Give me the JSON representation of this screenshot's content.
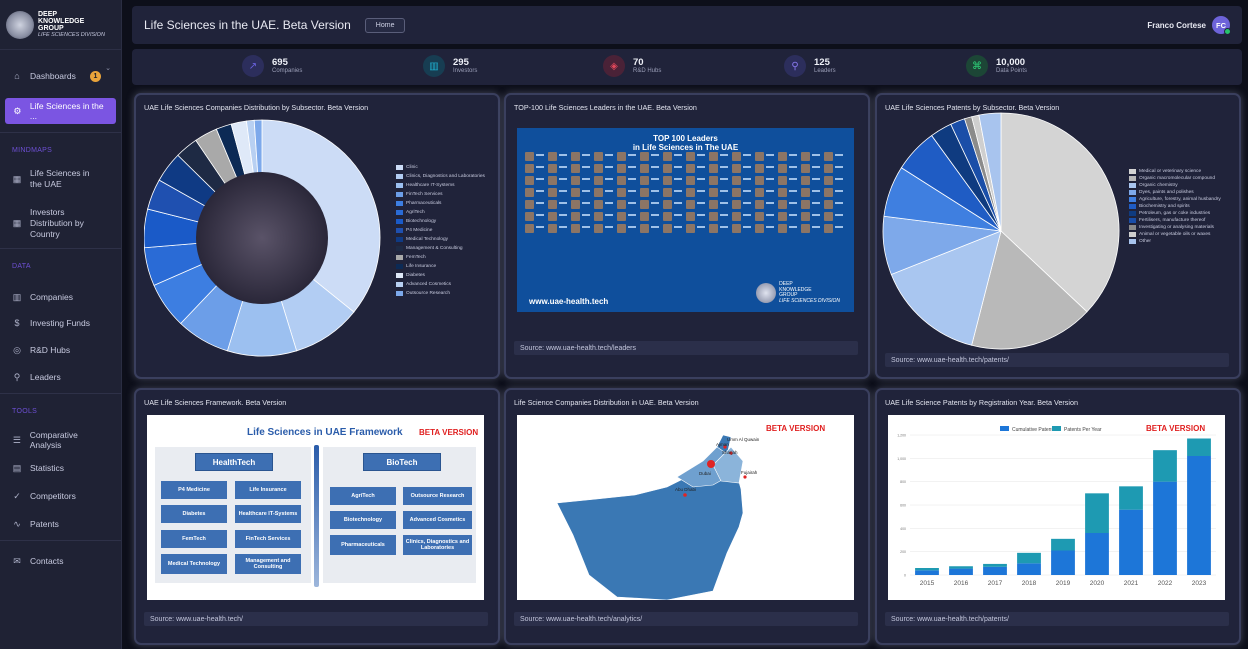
{
  "brand": {
    "line1": "DEEP",
    "line2": "KNOWLEDGE",
    "line3": "GROUP",
    "line4": "LIFE SCIENCES DIVISION"
  },
  "sidebar": {
    "dashboard": {
      "label": "Dashboards",
      "badge": "1"
    },
    "active": {
      "label": "Life Sciences in the ..."
    },
    "sections": {
      "mindmaps": "MINDMAPS",
      "data": "DATA",
      "tools": "TOOLS"
    },
    "mindmaps": [
      {
        "label": "Life Sciences in the UAE"
      },
      {
        "label": "Investors Distribution by Country"
      }
    ],
    "data": [
      {
        "label": "Companies"
      },
      {
        "label": "Investing Funds"
      },
      {
        "label": "R&D Hubs"
      },
      {
        "label": "Leaders"
      }
    ],
    "tools": [
      {
        "label": "Comparative Analysis"
      },
      {
        "label": "Statistics"
      },
      {
        "label": "Competitors"
      },
      {
        "label": "Patents"
      }
    ],
    "contacts": {
      "label": "Contacts"
    }
  },
  "header": {
    "title": "Life Sciences in the UAE. Beta Version",
    "home_label": "Home",
    "user_name": "Franco Cortese",
    "user_initials": "FC"
  },
  "stats": [
    {
      "value": "695",
      "label": "Companies",
      "icon": "trend-icon",
      "color": "#6a63e0",
      "bg": "#2c2e5c"
    },
    {
      "value": "295",
      "label": "Investors",
      "icon": "building-icon",
      "color": "#1fb5d6",
      "bg": "#173d52"
    },
    {
      "value": "70",
      "label": "R&D Hubs",
      "icon": "cube-icon",
      "color": "#e0475a",
      "bg": "#4a2237"
    },
    {
      "value": "125",
      "label": "Leaders",
      "icon": "user-icon",
      "color": "#8a7af0",
      "bg": "#2c2e5c"
    },
    {
      "value": "10,000",
      "label": "Data Points",
      "icon": "command-icon",
      "color": "#2ed47a",
      "bg": "#1c4636"
    }
  ],
  "cards": {
    "subsector": {
      "title": "UAE Life Sciences Companies Distribution by Subsector. Beta Version"
    },
    "leaders": {
      "title": "TOP-100 Life Sciences Leaders in the UAE. Beta Version",
      "banner_line1": "TOP 100 Leaders",
      "banner_line2": "in Life Sciences in The UAE",
      "banner_url": "www.uae-health.tech",
      "logo_line1": "DEEP",
      "logo_line2": "KNOWLEDGE",
      "logo_line3": "GROUP",
      "logo_line4": "LIFE SCIENCES DIVISION",
      "source": "Source:  www.uae-health.tech/leaders"
    },
    "patents_subsector": {
      "title": "UAE Life Sciences Patents by Subsector. Beta Version",
      "source": "Source: www.uae-health.tech/patents/"
    },
    "framework": {
      "title": "UAE Life Sciences Framework. Beta Version",
      "diagram_title": "Life Sciences in UAE Framework",
      "beta": "BETA VERSION",
      "healthtech": "HealthTech",
      "biotech": "BioTech",
      "health_items": [
        "P4 Medicine",
        "Life Insurance",
        "Diabetes",
        "Healthcare IT-Systems",
        "FemTech",
        "FinTech Services",
        "Medical Technology",
        "Management and Consulting"
      ],
      "bio_items": [
        "AgriTech",
        "Outsource Research",
        "Biotechnology",
        "Advanced Cosmetics",
        "Pharmaceuticals",
        "Clinics, Diagnostics and Laboratories"
      ],
      "source": "Source: www.uae-health.tech/"
    },
    "map": {
      "title": "Life Science Companies Distribution in UAE. Beta Version",
      "beta": "BETA VERSION",
      "labels": [
        "Ajman",
        "Umm Al Quwain",
        "Sharjah",
        "Fujairah",
        "Dubai",
        "Abu Dhabi"
      ],
      "source": "Source: www.uae-health.tech/analytics/"
    },
    "patents_year": {
      "title": "UAE Life Science Patents by Registration Year. Beta Version",
      "beta": "BETA VERSION",
      "source": "Source: www.uae-health.tech/patents/"
    }
  },
  "chart_data": [
    {
      "type": "pie",
      "variant": "donut",
      "categories": [
        "Clinic",
        "Clinics, Diagnostics and Laboratories",
        "Healthcare IT-Systems",
        "FinTech Services",
        "Pharmaceuticals",
        "AgriTech",
        "Biotechnology",
        "P4 Medicine",
        "Medical Technology",
        "Management & Consulting",
        "FemTech",
        "Life Insurance",
        "Diabetes",
        "Advanced Cosmetics",
        "Outsource Research"
      ],
      "values": [
        34,
        9,
        9,
        7,
        6,
        5,
        5,
        4,
        4,
        3,
        3,
        2,
        2,
        1,
        1
      ],
      "colors": [
        "#ccdcf6",
        "#b2cdf3",
        "#9cc0f0",
        "#6c9ee8",
        "#3d7ee1",
        "#2a6bd6",
        "#1a5ac8",
        "#1f50b0",
        "#0f3a84",
        "#1e2a44",
        "#a9a9a9",
        "#0c2a55",
        "#dfe9f8",
        "#b8d0f2",
        "#7da9eb"
      ],
      "legend": "right"
    },
    {
      "type": "pie",
      "categories": [
        "Medical or veterinary science",
        "Organic macromolecular compound",
        "Organic chemistry",
        "Dyes, paints and polishes",
        "Agriculture, forestry, animal husbandry",
        "Biochemistry and spirits",
        "Petroleum, gas or coke industries",
        "Fertilisers, manufacture thereof",
        "Investigating or analysing materials",
        "Animal or vegetable oils or waxes",
        "Other"
      ],
      "values": [
        37,
        17,
        15,
        8,
        7,
        6,
        3,
        2,
        1,
        1,
        3
      ],
      "colors": [
        "#d4d4d4",
        "#b9b9b9",
        "#a9c6f0",
        "#7ea9ea",
        "#3f7fe0",
        "#1f5cc4",
        "#0f3b80",
        "#1a4ea8",
        "#8b8b8b",
        "#cfcfcf",
        "#a8c4ee"
      ],
      "legend": "right"
    },
    {
      "type": "bar",
      "categories": [
        "2015",
        "2016",
        "2017",
        "2018",
        "2019",
        "2020",
        "2021",
        "2022",
        "2023"
      ],
      "series": [
        {
          "name": "Cumulative Patents",
          "values": [
            40,
            55,
            70,
            100,
            210,
            360,
            560,
            800,
            1020
          ]
        },
        {
          "name": "Patents Per Year",
          "values": [
            20,
            20,
            25,
            90,
            100,
            340,
            200,
            270,
            150
          ]
        }
      ],
      "stacked": true,
      "colors": [
        "#1d76d8",
        "#1e9ab2"
      ],
      "ylim": [
        0,
        1200
      ],
      "yticks": [
        "1,200",
        "1,000",
        "800",
        "600",
        "400",
        "200",
        "0"
      ],
      "legend": "top"
    }
  ]
}
